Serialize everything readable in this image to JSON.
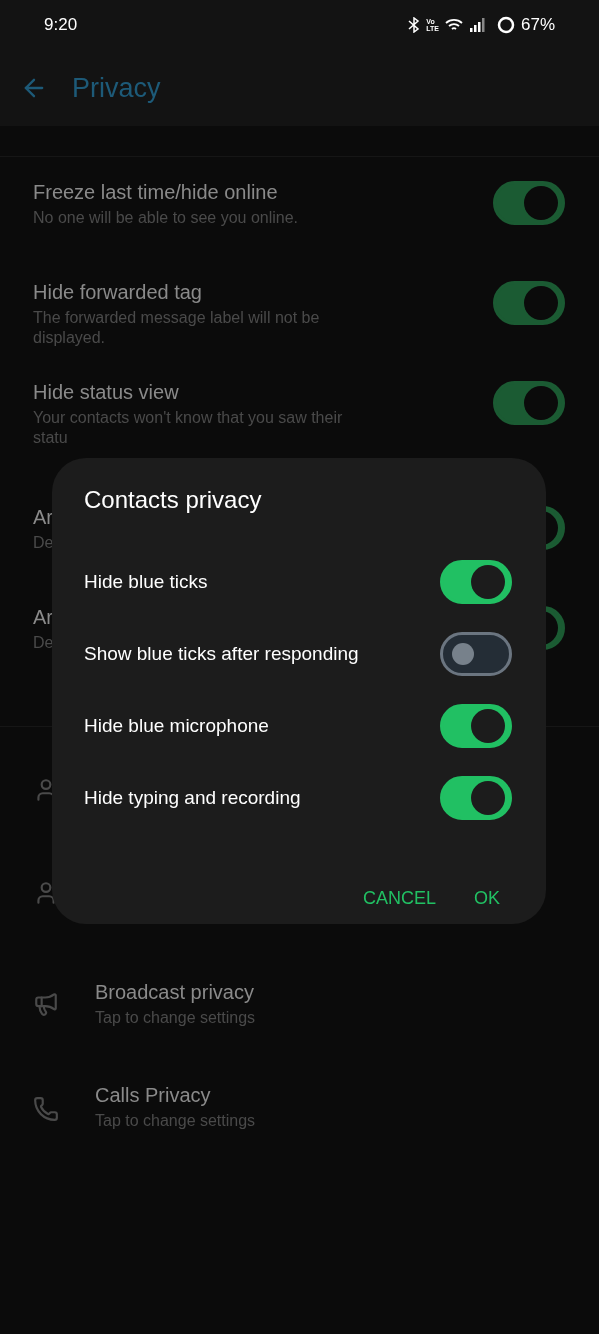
{
  "status_bar": {
    "time": "9:20",
    "volte": [
      "Vo",
      "LTE"
    ],
    "battery": "67%"
  },
  "app_bar": {
    "title": "Privacy"
  },
  "settings": [
    {
      "kind": "toggle",
      "title": "Freeze last time/hide online",
      "description": "No one will be able to see you online.",
      "on": true
    },
    {
      "kind": "toggle",
      "title": "Hide forwarded tag",
      "description": "The forwarded message label will not be displayed.",
      "on": true
    },
    {
      "kind": "toggle",
      "title": "Hide status view",
      "description": "Your contacts won't know that you saw their statu",
      "on": true
    },
    {
      "kind": "toggle",
      "title": "Ar",
      "description": "De",
      "on": true
    },
    {
      "kind": "toggle",
      "title": "Ar",
      "description": "De",
      "on": true
    }
  ],
  "links": [
    {
      "kind": "person"
    },
    {
      "kind": "person"
    },
    {
      "kind": "broadcast",
      "title": "Broadcast privacy",
      "description": "Tap to change settings"
    },
    {
      "kind": "call",
      "title": "Calls Privacy",
      "description": "Tap to change settings"
    }
  ],
  "dialog": {
    "title": "Contacts privacy",
    "options": [
      {
        "label": "Hide blue ticks",
        "on": true
      },
      {
        "label": "Show blue ticks after responding",
        "on": false
      },
      {
        "label": "Hide blue microphone",
        "on": true
      },
      {
        "label": "Hide typing and recording",
        "on": true
      }
    ],
    "buttons": [
      "CANCEL",
      "OK"
    ]
  }
}
